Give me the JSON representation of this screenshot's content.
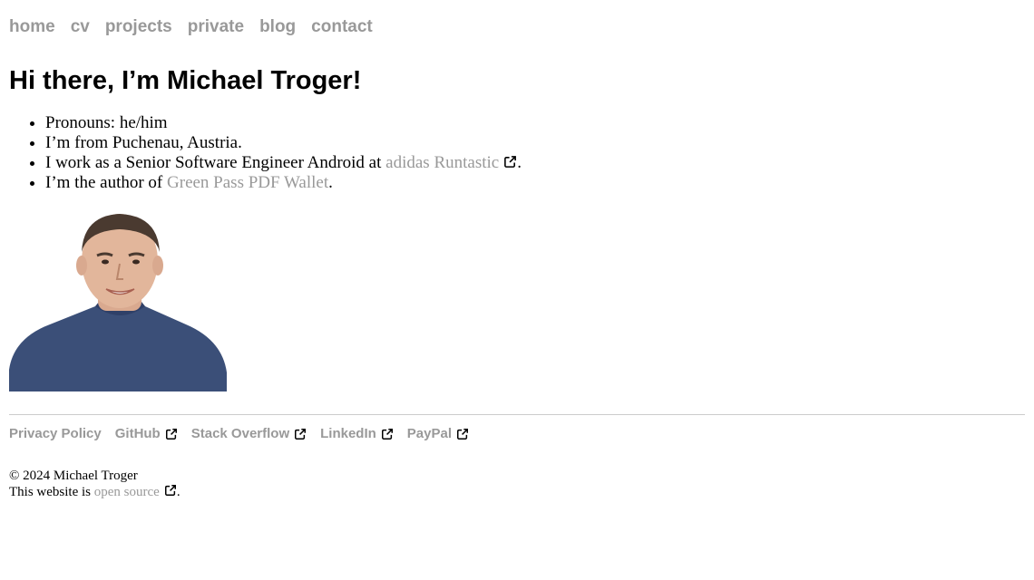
{
  "nav": {
    "items": [
      {
        "label": "home"
      },
      {
        "label": "cv"
      },
      {
        "label": "projects"
      },
      {
        "label": "private"
      },
      {
        "label": "blog"
      },
      {
        "label": "contact"
      }
    ]
  },
  "heading": "Hi there, I’m Michael Troger!",
  "facts": {
    "pronouns": "Pronouns: he/him",
    "from": "I’m from Puchenau, Austria.",
    "work_prefix": "I work as a Senior Software Engineer Android at ",
    "work_link": "adidas Runtastic",
    "work_suffix": ".",
    "author_prefix": "I’m the author of ",
    "author_link": "Green Pass PDF Wallet",
    "author_suffix": "."
  },
  "photo": {
    "icon": "portrait-photo",
    "colors": {
      "shirt": "#3b4f78",
      "background": "#ffffff"
    }
  },
  "footer": {
    "links": [
      {
        "label": "Privacy Policy"
      },
      {
        "label": "GitHub"
      },
      {
        "label": "Stack Overflow"
      },
      {
        "label": "LinkedIn"
      },
      {
        "label": "PayPal"
      }
    ],
    "copyright": "© 2024 Michael Troger",
    "source_prefix": "This website is ",
    "source_link": "open source",
    "source_suffix": "."
  },
  "colors": {
    "link": "#999999",
    "text": "#000000",
    "divider": "#cccccc"
  }
}
